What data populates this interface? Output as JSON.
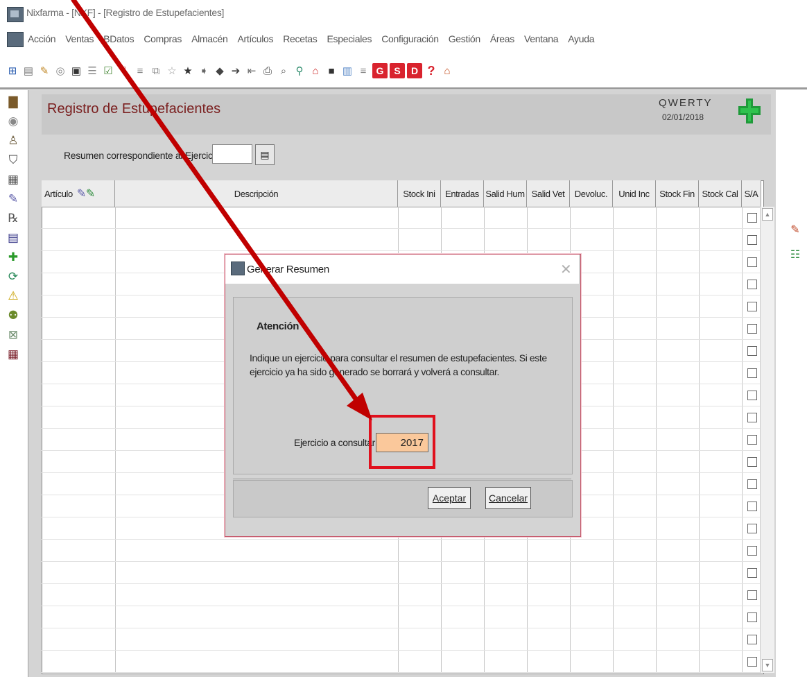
{
  "window": {
    "title": "Nixfarma - [NXF] - [Registro de Estupefacientes]"
  },
  "menu": {
    "items": [
      "Acción",
      "Ventas",
      "BDatos",
      "Compras",
      "Almacén",
      "Artículos",
      "Recetas",
      "Especiales",
      "Configuración",
      "Gestión",
      "Áreas",
      "Ventana",
      "Ayuda"
    ]
  },
  "toolbar": {
    "letter_buttons": [
      "G",
      "S",
      "D"
    ],
    "help": "?"
  },
  "header": {
    "page_title": "Registro de Estupefacientes",
    "company": "QWERTY",
    "date": "02/01/2018"
  },
  "summary": {
    "label": "Resumen correspondiente al Ejercicio",
    "value": ""
  },
  "grid": {
    "columns": [
      "Artículo",
      "Descripción",
      "Stock Ini",
      "Entradas",
      "Salid Hum",
      "Salid Vet",
      "Devoluc.",
      "Unid Inc",
      "Stock Fin",
      "Stock Cal",
      "S/A"
    ]
  },
  "dialog": {
    "title": "Generar Resumen",
    "heading": "Atención",
    "message": "Indique un ejercicio para consultar el resumen de estupefacientes. Si este ejercicio ya ha sido generado se borrará y volverá a consultar.",
    "field_label": "Ejercicio a consultar",
    "field_value": "2017",
    "accept_label": "Aceptar",
    "cancel_label": "Cancelar"
  },
  "colors": {
    "highlight": "#e0101d",
    "arrow": "#c00000",
    "input_bg": "#fac89b",
    "title": "#7a1f1f"
  }
}
